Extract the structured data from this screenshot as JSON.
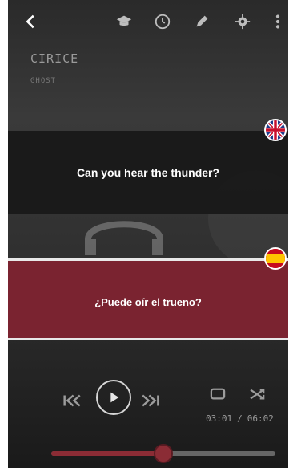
{
  "app": {
    "track": {
      "title": "CIRICE",
      "album": "GHOST"
    },
    "lyrics": {
      "original": "Can you hear the thunder?",
      "translation": "¿Puede oír el trueno?",
      "original_flag": "uk-flag-icon",
      "translation_flag": "spain-flag-icon"
    },
    "player": {
      "current_time": "03:01",
      "separator": "/",
      "total_time": "06:02",
      "progress_fraction": 0.5
    },
    "toolbar": {
      "icons": [
        "back-icon",
        "graduation-cap-icon",
        "clock-icon",
        "pencil-icon",
        "gear-icon",
        "more-vertical-icon"
      ]
    },
    "colors": {
      "accent": "#8b2c35",
      "translation_bg": "#7a2330"
    }
  }
}
